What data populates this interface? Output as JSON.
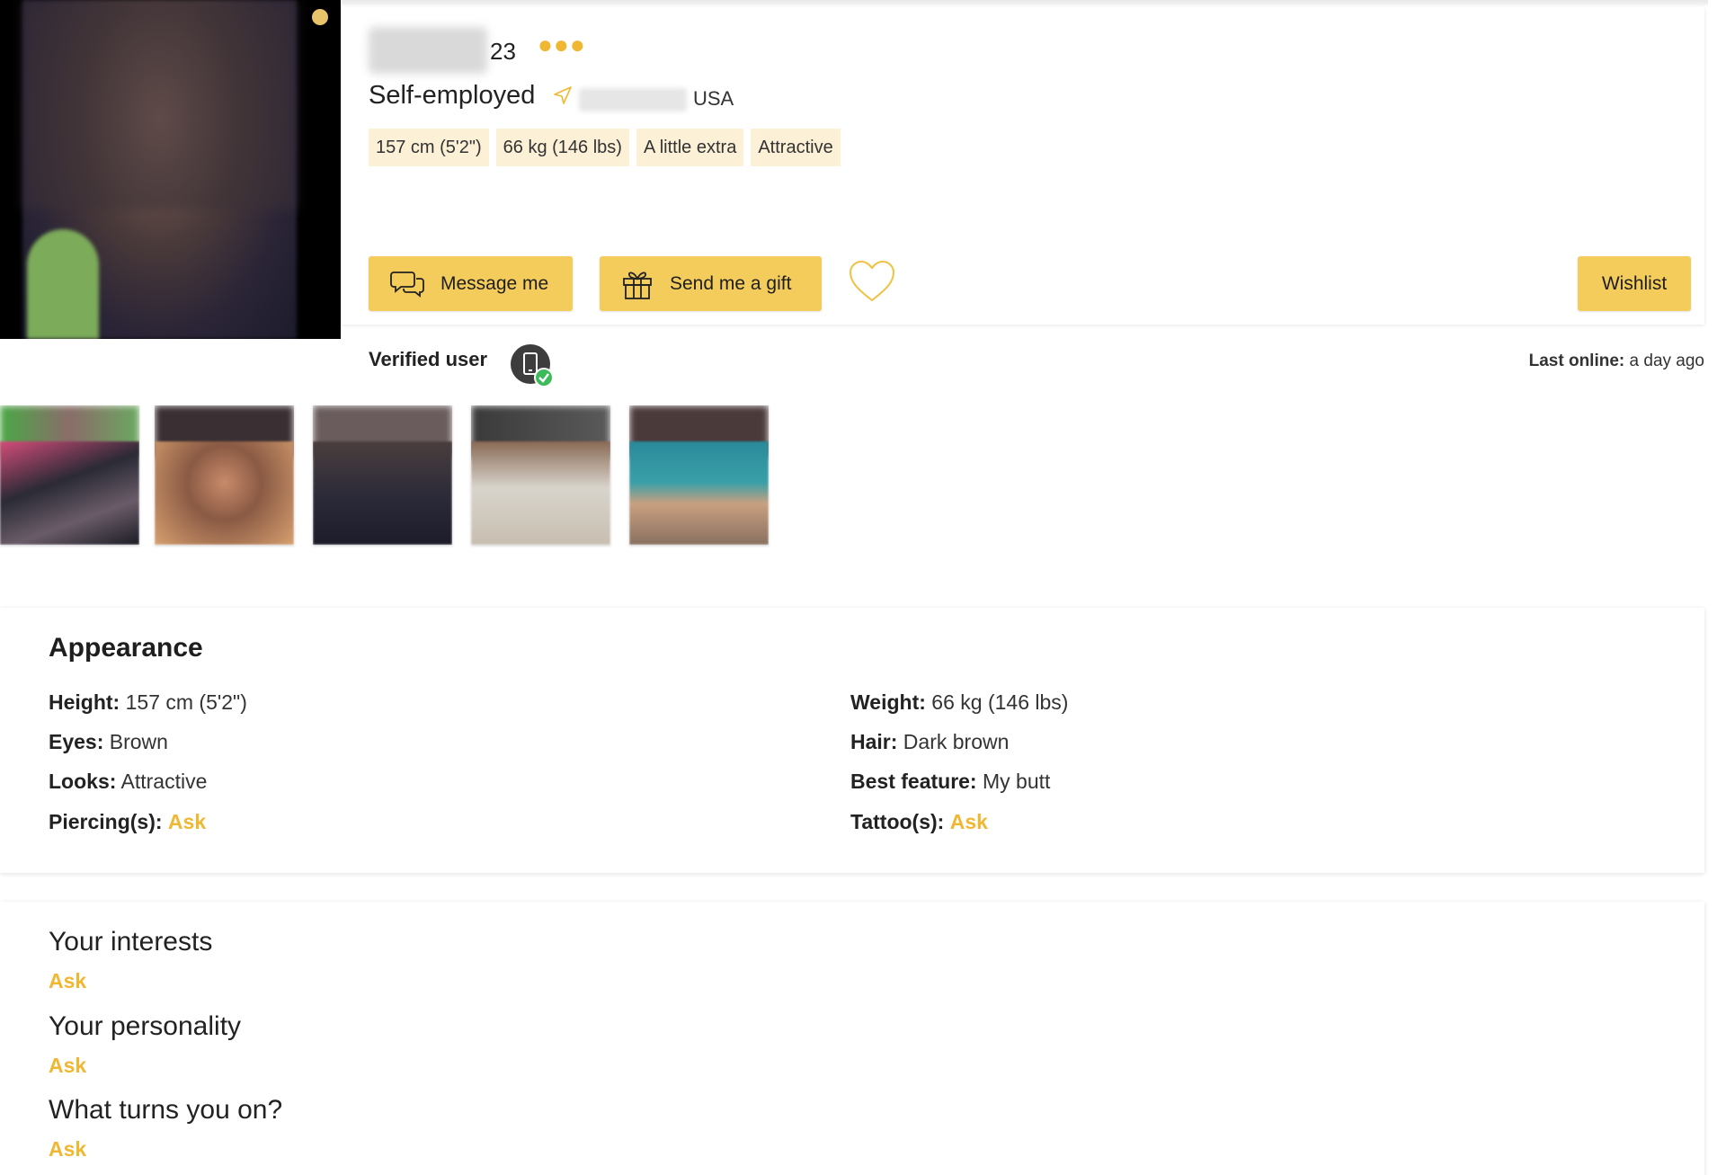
{
  "profile": {
    "age": "23",
    "occupation": "Self-employed",
    "country": "USA",
    "tags": [
      "157 cm (5'2\")",
      "66 kg (146 lbs)",
      "A little extra",
      "Attractive"
    ],
    "more_icon": "more-dots-icon",
    "location_icon": "location-arrow-icon"
  },
  "actions": {
    "message_label": "Message me",
    "gift_label": "Send me a gift",
    "wishlist_label": "Wishlist",
    "favorite_icon": "heart-icon"
  },
  "status": {
    "verified_label": "Verified user",
    "last_online_label": "Last online:",
    "last_online_value": "a day ago"
  },
  "appearance": {
    "title": "Appearance",
    "left": [
      {
        "key": "Height:",
        "value": "157 cm (5'2\")"
      },
      {
        "key": "Eyes:",
        "value": "Brown"
      },
      {
        "key": "Looks:",
        "value": "Attractive"
      },
      {
        "key": "Piercing(s):",
        "value": "Ask"
      }
    ],
    "right": [
      {
        "key": "Weight:",
        "value": "66 kg (146 lbs)"
      },
      {
        "key": "Hair:",
        "value": "Dark brown"
      },
      {
        "key": "Best feature:",
        "value": "My butt"
      },
      {
        "key": "Tattoo(s):",
        "value": "Ask"
      }
    ]
  },
  "about": [
    {
      "question": "Your interests",
      "answer": "Ask"
    },
    {
      "question": "Your personality",
      "answer": "Ask"
    },
    {
      "question": "What turns you on?",
      "answer": "Ask"
    }
  ],
  "colors": {
    "accent": "#f3cc5b",
    "ask": "#f0b832",
    "tag_bg": "#fcf0d6"
  }
}
